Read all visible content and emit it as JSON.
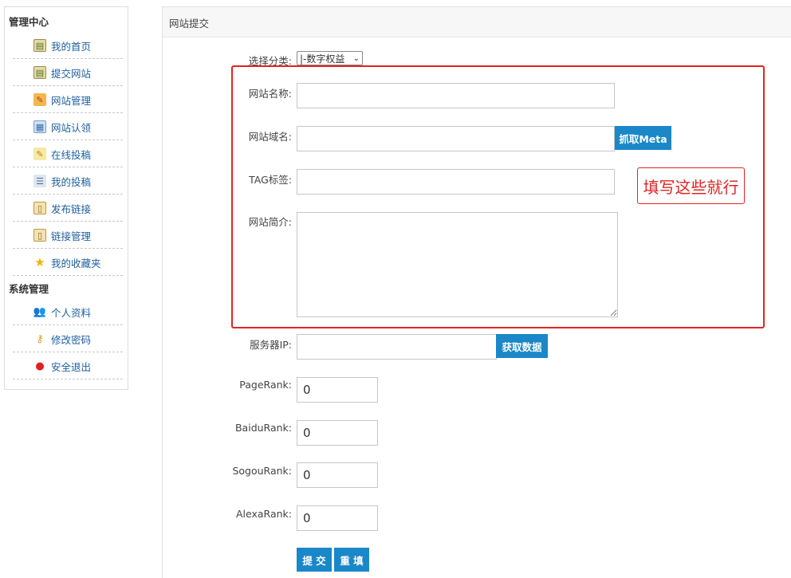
{
  "sidebar": {
    "sections": [
      {
        "title": "管理中心"
      },
      {
        "title": "系统管理"
      }
    ],
    "items": [
      {
        "label": "我的首页",
        "icon": "clipboard-icon"
      },
      {
        "label": "提交网站",
        "icon": "clipboard-icon"
      },
      {
        "label": "网站管理",
        "icon": "folder-edit-icon"
      },
      {
        "label": "网站认领",
        "icon": "image-icon"
      },
      {
        "label": "在线投稿",
        "icon": "pencil-note-icon"
      },
      {
        "label": "我的投稿",
        "icon": "stack-icon"
      },
      {
        "label": "发布链接",
        "icon": "document-icon"
      },
      {
        "label": "链接管理",
        "icon": "document-icon"
      },
      {
        "label": "我的收藏夹",
        "icon": "star-icon"
      },
      {
        "label": "个人资料",
        "icon": "users-icon"
      },
      {
        "label": "修改密码",
        "icon": "key-icon"
      },
      {
        "label": "安全退出",
        "icon": "power-icon"
      }
    ]
  },
  "panel": {
    "title": "网站提交"
  },
  "form": {
    "category": {
      "label": "选择分类:",
      "selected": "|-数字权益"
    },
    "site_name": {
      "label": "网站名称:",
      "value": ""
    },
    "site_domain": {
      "label": "网站域名:",
      "value": "",
      "button": "抓取Meta"
    },
    "tags": {
      "label": "TAG标签:",
      "value": ""
    },
    "intro": {
      "label": "网站简介:",
      "value": ""
    },
    "server_ip": {
      "label": "服务器IP:",
      "value": "",
      "button": "获取数据"
    },
    "pagerank": {
      "label": "PageRank:",
      "value": "0"
    },
    "baidurank": {
      "label": "BaiduRank:",
      "value": "0"
    },
    "sogourank": {
      "label": "SogouRank:",
      "value": "0"
    },
    "alexarank": {
      "label": "AlexaRank:",
      "value": "0"
    },
    "submit_label": "提 交",
    "reset_label": "重 填"
  },
  "annotation": {
    "text": "填写这些就行",
    "color": "#e02424"
  },
  "colors": {
    "button_blue": "#1a87c9",
    "link_blue": "#1f5f9e",
    "highlight_red": "#e02424"
  }
}
